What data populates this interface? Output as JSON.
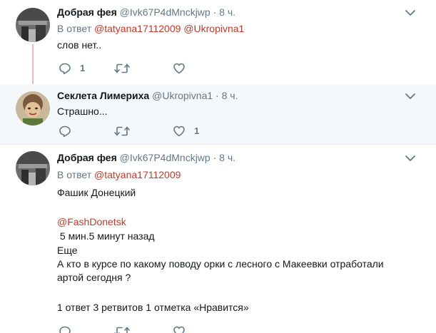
{
  "tweets": [
    {
      "name": "Добрая фея",
      "handle": "@Ivk67P4dMnckjwp",
      "dot": "·",
      "time": "8 ч.",
      "reply_prefix": "В ответ",
      "reply_mentions": [
        "@tatyana17112009",
        "@Ukropivna1"
      ],
      "text": "слов нет..",
      "reply_count": "1",
      "retweet_count": "",
      "like_count": ""
    },
    {
      "name": "Секлета Лимериха",
      "handle": "@Ukropivna1",
      "dot": "·",
      "time": "8 ч.",
      "text": "Страшно...",
      "reply_count": "",
      "retweet_count": "",
      "like_count": "1"
    },
    {
      "name": "Добрая фея",
      "handle": "@Ivk67P4dMnckjwp",
      "dot": "·",
      "time": "8 ч.",
      "reply_prefix": "В ответ",
      "reply_mentions": [
        "@tatyana17112009"
      ],
      "lines": {
        "l1": "Фашик Донецкий",
        "mention": "@FashDonetsk",
        "l3": " 5 мин.5 минут назад",
        "l4": "Еще",
        "l5": "А кто в курсе по какому поводу орки с лесного с Макеевки отработали артой сегодня ?",
        "l6": "1 ответ 3 ретвитов 1 отметка «Нравится»"
      }
    }
  ],
  "colors": {
    "accent_mention": "#c0392b",
    "muted": "#657786",
    "thread_line": "#e7b8c2",
    "highlight_bg": "#f5f8fa"
  },
  "icons": [
    "reply-icon",
    "retweet-icon",
    "like-icon",
    "chevron-down-icon"
  ]
}
